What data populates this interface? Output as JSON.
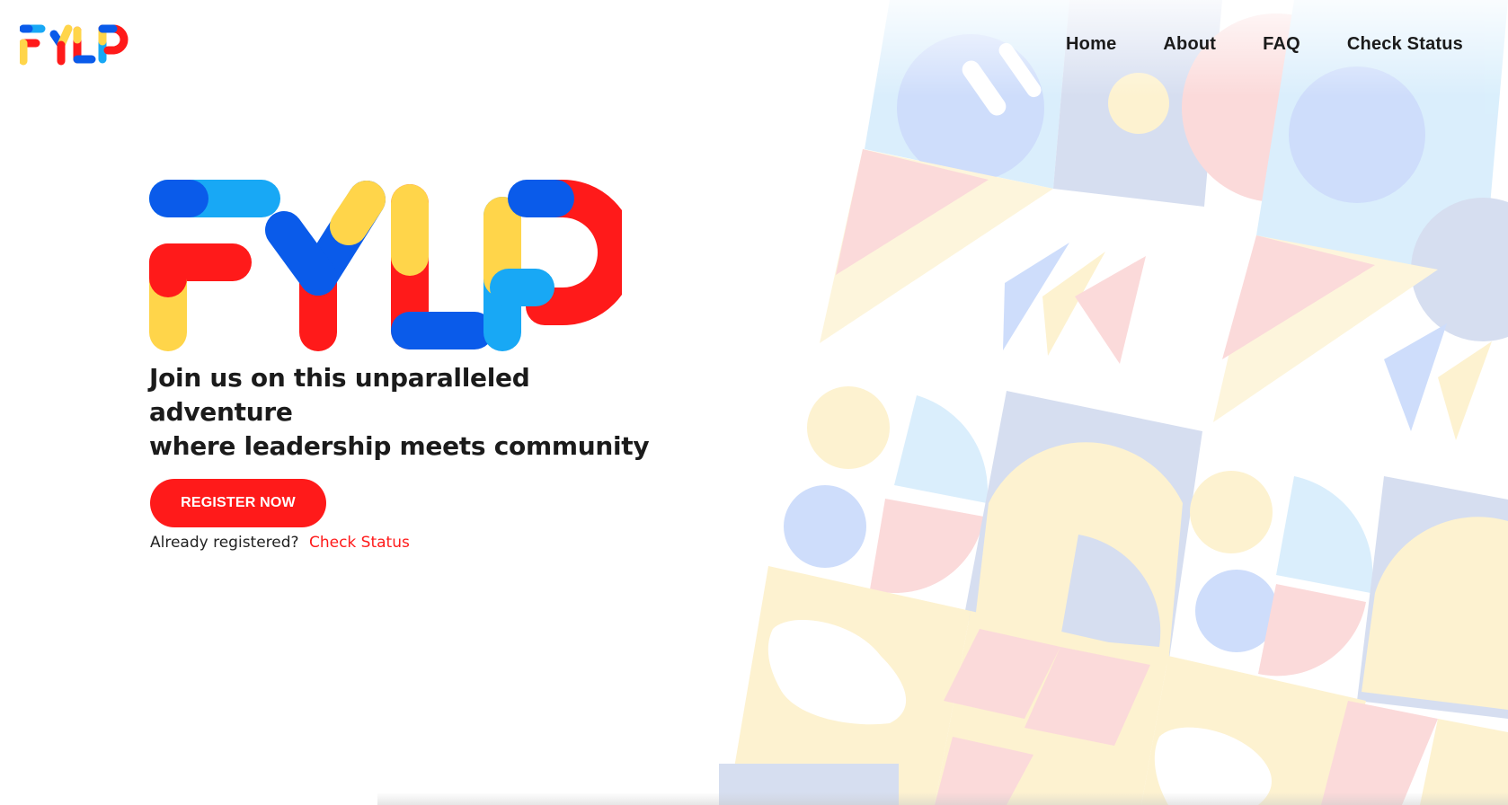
{
  "brand": {
    "logo_text": "FYLP"
  },
  "nav": {
    "items": [
      "Home",
      "About",
      "FAQ",
      "Check Status"
    ]
  },
  "hero": {
    "tagline_line1": "Join us on this unparalleled adventure",
    "tagline_line2": "where leadership meets community",
    "register_label": "REGISTER NOW",
    "already_text": "Already registered?",
    "check_status_link": "Check Status"
  },
  "colors": {
    "red": "#ff1a1a",
    "blue": "#0a5bea",
    "light_blue": "#18a8f5",
    "yellow": "#ffd54a",
    "text": "#1b1b1b"
  }
}
